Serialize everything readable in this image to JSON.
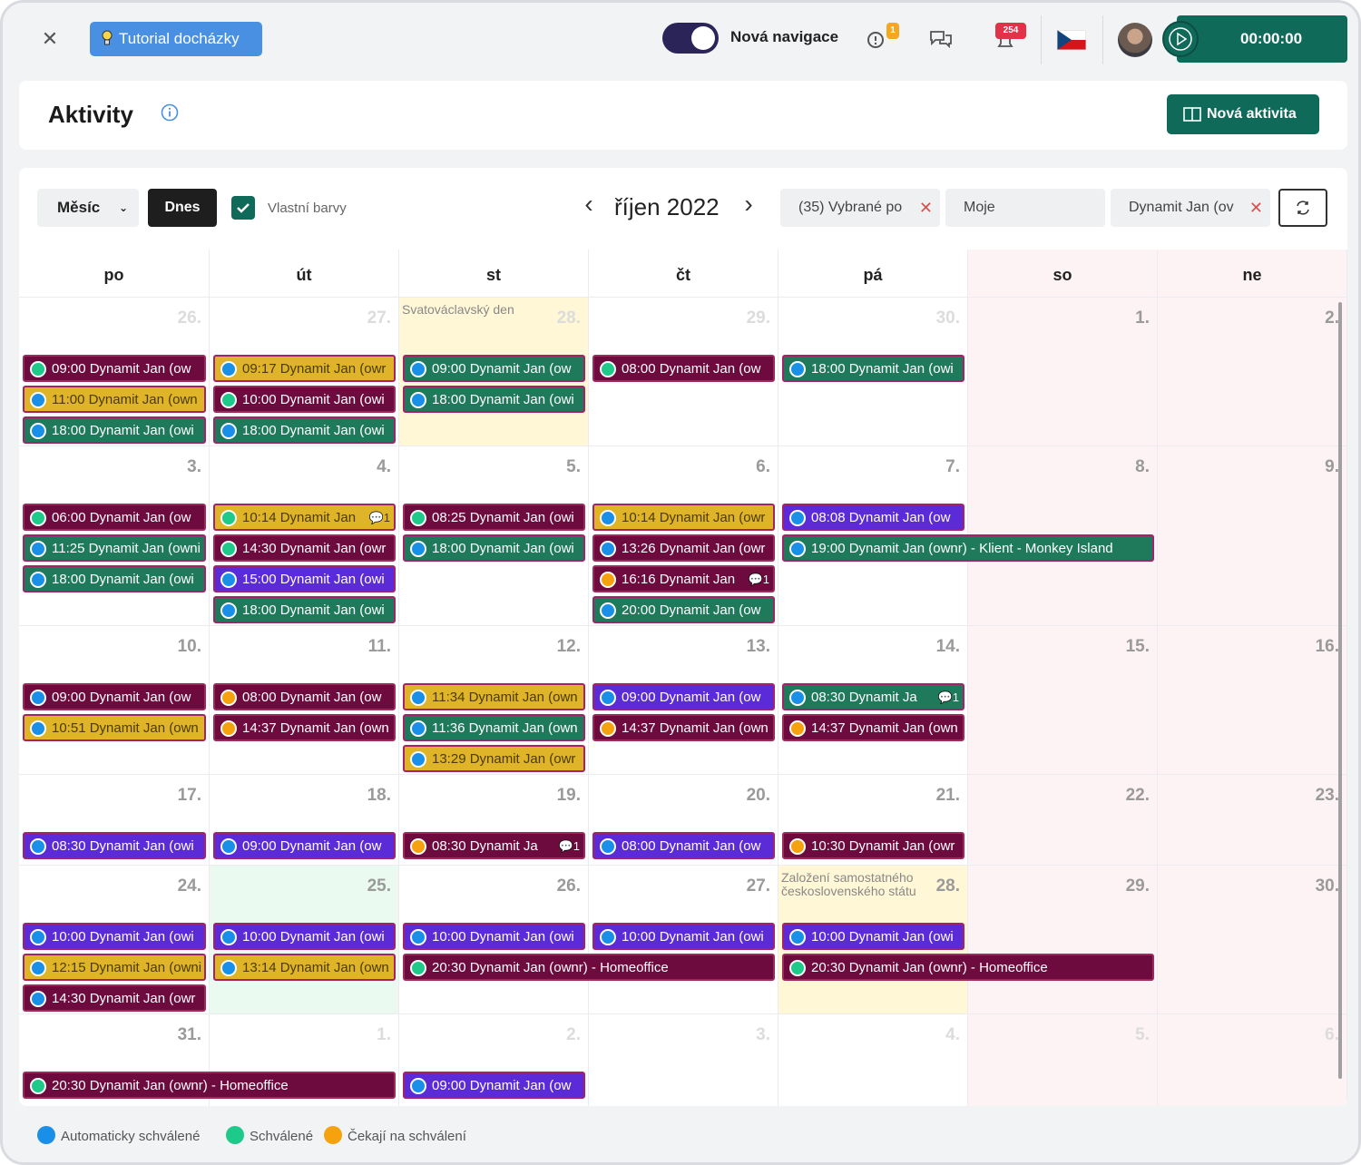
{
  "topbar": {
    "close_icon": "close-icon",
    "tutorial_label": "Tutorial docházky",
    "toggle_on": true,
    "nav_label": "Nová navigace",
    "alert_badge": "1",
    "notification_badge": "254",
    "timer": "00:00:00"
  },
  "header": {
    "title": "Aktivity",
    "new_activity_label": "Nová aktivita"
  },
  "toolbar": {
    "view_select": "Měsíc",
    "today_label": "Dnes",
    "custom_colors_label": "Vlastní barvy",
    "custom_colors_checked": true,
    "month_title": "říjen 2022",
    "filters": [
      "(35) Vybrané po",
      "Moje",
      "Dynamit Jan (ov"
    ]
  },
  "weekdays": [
    "po",
    "út",
    "st",
    "čt",
    "pá",
    "so",
    "ne"
  ],
  "weeks": [
    {
      "days": [
        "26.",
        "27.",
        "28.",
        "29.",
        "30.",
        "1.",
        "2."
      ],
      "other": [
        true,
        true,
        true,
        true,
        true,
        false,
        false
      ]
    },
    {
      "days": [
        "3.",
        "4.",
        "5.",
        "6.",
        "7.",
        "8.",
        "9."
      ],
      "other": [
        false,
        false,
        false,
        false,
        false,
        false,
        false
      ]
    },
    {
      "days": [
        "10.",
        "11.",
        "12.",
        "13.",
        "14.",
        "15.",
        "16."
      ],
      "other": [
        false,
        false,
        false,
        false,
        false,
        false,
        false
      ]
    },
    {
      "days": [
        "17.",
        "18.",
        "19.",
        "20.",
        "21.",
        "22.",
        "23."
      ],
      "other": [
        false,
        false,
        false,
        false,
        false,
        false,
        false
      ]
    },
    {
      "days": [
        "24.",
        "25.",
        "26.",
        "27.",
        "28.",
        "29.",
        "30."
      ],
      "other": [
        false,
        false,
        false,
        false,
        false,
        false,
        false
      ]
    },
    {
      "days": [
        "31.",
        "1.",
        "2.",
        "3.",
        "4.",
        "5.",
        "6."
      ],
      "other": [
        false,
        true,
        true,
        true,
        true,
        true,
        true
      ]
    }
  ],
  "holidays": [
    {
      "week": 0,
      "day": 2,
      "name": "Svatováclavský den"
    },
    {
      "week": 4,
      "day": 4,
      "name": "Založení samostatného československého státu"
    }
  ],
  "events": [
    {
      "week": 0,
      "day": 0,
      "row": 0,
      "span": 1,
      "text": "09:00 Dynamit Jan (ow",
      "bg": "maroon",
      "dot": "teal"
    },
    {
      "week": 0,
      "day": 0,
      "row": 1,
      "span": 1,
      "text": "11:00 Dynamit Jan (own",
      "bg": "gold",
      "dot": "blue"
    },
    {
      "week": 0,
      "day": 0,
      "row": 2,
      "span": 1,
      "text": "18:00 Dynamit Jan (owi",
      "bg": "green",
      "dot": "blue"
    },
    {
      "week": 0,
      "day": 1,
      "row": 0,
      "span": 1,
      "text": "09:17 Dynamit Jan (owr",
      "bg": "gold",
      "dot": "blue"
    },
    {
      "week": 0,
      "day": 1,
      "row": 1,
      "span": 1,
      "text": "10:00 Dynamit Jan (owi",
      "bg": "maroon",
      "dot": "teal"
    },
    {
      "week": 0,
      "day": 1,
      "row": 2,
      "span": 1,
      "text": "18:00 Dynamit Jan (owi",
      "bg": "green",
      "dot": "blue"
    },
    {
      "week": 0,
      "day": 2,
      "row": 0,
      "span": 1,
      "text": "09:00 Dynamit Jan (ow",
      "bg": "green",
      "dot": "blue"
    },
    {
      "week": 0,
      "day": 2,
      "row": 1,
      "span": 1,
      "text": "18:00 Dynamit Jan (owi",
      "bg": "green",
      "dot": "blue"
    },
    {
      "week": 0,
      "day": 3,
      "row": 0,
      "span": 1,
      "text": "08:00 Dynamit Jan (ow",
      "bg": "maroon",
      "dot": "teal"
    },
    {
      "week": 0,
      "day": 4,
      "row": 0,
      "span": 1,
      "text": "18:00 Dynamit Jan (owi",
      "bg": "green",
      "dot": "blue"
    },
    {
      "week": 1,
      "day": 0,
      "row": 0,
      "span": 1,
      "text": "06:00 Dynamit Jan (ow",
      "bg": "maroon",
      "dot": "teal"
    },
    {
      "week": 1,
      "day": 0,
      "row": 1,
      "span": 1,
      "text": "11:25 Dynamit Jan (owni",
      "bg": "green",
      "dot": "blue"
    },
    {
      "week": 1,
      "day": 0,
      "row": 2,
      "span": 1,
      "text": "18:00 Dynamit Jan (owi",
      "bg": "green",
      "dot": "blue"
    },
    {
      "week": 1,
      "day": 1,
      "row": 0,
      "span": 1,
      "text": "10:14 Dynamit Jan",
      "bg": "gold",
      "dot": "teal",
      "comments": "1"
    },
    {
      "week": 1,
      "day": 1,
      "row": 1,
      "span": 1,
      "text": "14:30 Dynamit Jan (owr",
      "bg": "maroon",
      "dot": "teal"
    },
    {
      "week": 1,
      "day": 1,
      "row": 2,
      "span": 1,
      "text": "15:00 Dynamit Jan (owi",
      "bg": "purple",
      "dot": "blue"
    },
    {
      "week": 1,
      "day": 1,
      "row": 3,
      "span": 1,
      "text": "18:00 Dynamit Jan (owi",
      "bg": "green",
      "dot": "blue"
    },
    {
      "week": 1,
      "day": 2,
      "row": 0,
      "span": 1,
      "text": "08:25 Dynamit Jan (owi",
      "bg": "maroon",
      "dot": "teal"
    },
    {
      "week": 1,
      "day": 2,
      "row": 1,
      "span": 1,
      "text": "18:00 Dynamit Jan (owi",
      "bg": "green",
      "dot": "blue"
    },
    {
      "week": 1,
      "day": 3,
      "row": 0,
      "span": 1,
      "text": "10:14 Dynamit Jan (owr",
      "bg": "gold",
      "dot": "blue"
    },
    {
      "week": 1,
      "day": 3,
      "row": 1,
      "span": 1,
      "text": "13:26 Dynamit Jan (owr",
      "bg": "maroon",
      "dot": "blue"
    },
    {
      "week": 1,
      "day": 3,
      "row": 2,
      "span": 1,
      "text": "16:16 Dynamit Jan",
      "bg": "maroon",
      "dot": "orange",
      "comments": "1"
    },
    {
      "week": 1,
      "day": 3,
      "row": 3,
      "span": 1,
      "text": "20:00 Dynamit Jan (ow",
      "bg": "green",
      "dot": "blue"
    },
    {
      "week": 1,
      "day": 4,
      "row": 0,
      "span": 1,
      "text": "08:08 Dynamit Jan (ow",
      "bg": "purple",
      "dot": "blue"
    },
    {
      "week": 1,
      "day": 4,
      "row": 1,
      "span": 2,
      "text": "19:00 Dynamit Jan (ownr) - Klient - Monkey Island",
      "bg": "green",
      "dot": "blue"
    },
    {
      "week": 2,
      "day": 0,
      "row": 0,
      "span": 1,
      "text": "09:00 Dynamit Jan (ow",
      "bg": "maroon",
      "dot": "blue"
    },
    {
      "week": 2,
      "day": 0,
      "row": 1,
      "span": 1,
      "text": "10:51 Dynamit Jan (own",
      "bg": "gold",
      "dot": "blue"
    },
    {
      "week": 2,
      "day": 1,
      "row": 0,
      "span": 1,
      "text": "08:00 Dynamit Jan (ow",
      "bg": "maroon",
      "dot": "orange"
    },
    {
      "week": 2,
      "day": 1,
      "row": 1,
      "span": 1,
      "text": "14:37 Dynamit Jan (own",
      "bg": "maroon",
      "dot": "orange"
    },
    {
      "week": 2,
      "day": 2,
      "row": 0,
      "span": 1,
      "text": "11:34 Dynamit Jan (own",
      "bg": "gold",
      "dot": "blue"
    },
    {
      "week": 2,
      "day": 2,
      "row": 1,
      "span": 1,
      "text": "11:36 Dynamit Jan (own",
      "bg": "green",
      "dot": "blue"
    },
    {
      "week": 2,
      "day": 2,
      "row": 2,
      "span": 1,
      "text": "13:29 Dynamit Jan (owr",
      "bg": "gold",
      "dot": "blue"
    },
    {
      "week": 2,
      "day": 3,
      "row": 0,
      "span": 1,
      "text": "09:00 Dynamit Jan (ow",
      "bg": "purple",
      "dot": "blue"
    },
    {
      "week": 2,
      "day": 3,
      "row": 1,
      "span": 1,
      "text": "14:37 Dynamit Jan (own",
      "bg": "maroon",
      "dot": "orange"
    },
    {
      "week": 2,
      "day": 4,
      "row": 0,
      "span": 1,
      "text": "08:30 Dynamit Ja",
      "bg": "green",
      "dot": "blue",
      "comments": "1"
    },
    {
      "week": 2,
      "day": 4,
      "row": 1,
      "span": 1,
      "text": "14:37 Dynamit Jan (own",
      "bg": "maroon",
      "dot": "orange"
    },
    {
      "week": 3,
      "day": 0,
      "row": 0,
      "span": 1,
      "text": "08:30 Dynamit Jan (owi",
      "bg": "purple",
      "dot": "blue"
    },
    {
      "week": 3,
      "day": 1,
      "row": 0,
      "span": 1,
      "text": "09:00 Dynamit Jan (ow",
      "bg": "purple",
      "dot": "blue"
    },
    {
      "week": 3,
      "day": 2,
      "row": 0,
      "span": 1,
      "text": "08:30 Dynamit Ja",
      "bg": "maroon",
      "dot": "orange",
      "comments": "1"
    },
    {
      "week": 3,
      "day": 3,
      "row": 0,
      "span": 1,
      "text": "08:00 Dynamit Jan (ow",
      "bg": "purple",
      "dot": "blue"
    },
    {
      "week": 3,
      "day": 4,
      "row": 0,
      "span": 1,
      "text": "10:30 Dynamit Jan (owr",
      "bg": "maroon",
      "dot": "orange"
    },
    {
      "week": 4,
      "day": 0,
      "row": 0,
      "span": 1,
      "text": "10:00 Dynamit Jan (owi",
      "bg": "purple",
      "dot": "blue"
    },
    {
      "week": 4,
      "day": 0,
      "row": 1,
      "span": 1,
      "text": "12:15 Dynamit Jan (owni",
      "bg": "gold",
      "dot": "blue"
    },
    {
      "week": 4,
      "day": 0,
      "row": 2,
      "span": 1,
      "text": "14:30 Dynamit Jan (owr",
      "bg": "maroon",
      "dot": "blue"
    },
    {
      "week": 4,
      "day": 1,
      "row": 0,
      "span": 1,
      "text": "10:00 Dynamit Jan (owi",
      "bg": "purple",
      "dot": "blue"
    },
    {
      "week": 4,
      "day": 1,
      "row": 1,
      "span": 1,
      "text": "13:14 Dynamit Jan (own",
      "bg": "gold",
      "dot": "blue"
    },
    {
      "week": 4,
      "day": 2,
      "row": 0,
      "span": 1,
      "text": "10:00 Dynamit Jan (owi",
      "bg": "purple",
      "dot": "blue"
    },
    {
      "week": 4,
      "day": 2,
      "row": 1,
      "span": 2,
      "text": "20:30 Dynamit Jan (ownr) - Homeoffice",
      "bg": "maroon",
      "dot": "teal"
    },
    {
      "week": 4,
      "day": 3,
      "row": 0,
      "span": 1,
      "text": "10:00 Dynamit Jan (owi",
      "bg": "purple",
      "dot": "blue"
    },
    {
      "week": 4,
      "day": 4,
      "row": 0,
      "span": 1,
      "text": "10:00 Dynamit Jan (owi",
      "bg": "purple",
      "dot": "blue"
    },
    {
      "week": 4,
      "day": 4,
      "row": 1,
      "span": 2,
      "text": "20:30 Dynamit Jan (ownr) - Homeoffice",
      "bg": "maroon",
      "dot": "teal"
    },
    {
      "week": 5,
      "day": 0,
      "row": 0,
      "span": 2,
      "text": "20:30 Dynamit Jan (ownr) - Homeoffice",
      "bg": "maroon",
      "dot": "teal"
    },
    {
      "week": 5,
      "day": 2,
      "row": 0,
      "span": 1,
      "text": "09:00 Dynamit Jan (ow",
      "bg": "purple",
      "dot": "blue"
    }
  ],
  "legend": [
    {
      "label": "Automaticky schválené",
      "color": "#1a8fe8"
    },
    {
      "label": "Schválené",
      "color": "#1ec98a"
    },
    {
      "label": "Čekají na schválení",
      "color": "#f5a20e"
    }
  ]
}
